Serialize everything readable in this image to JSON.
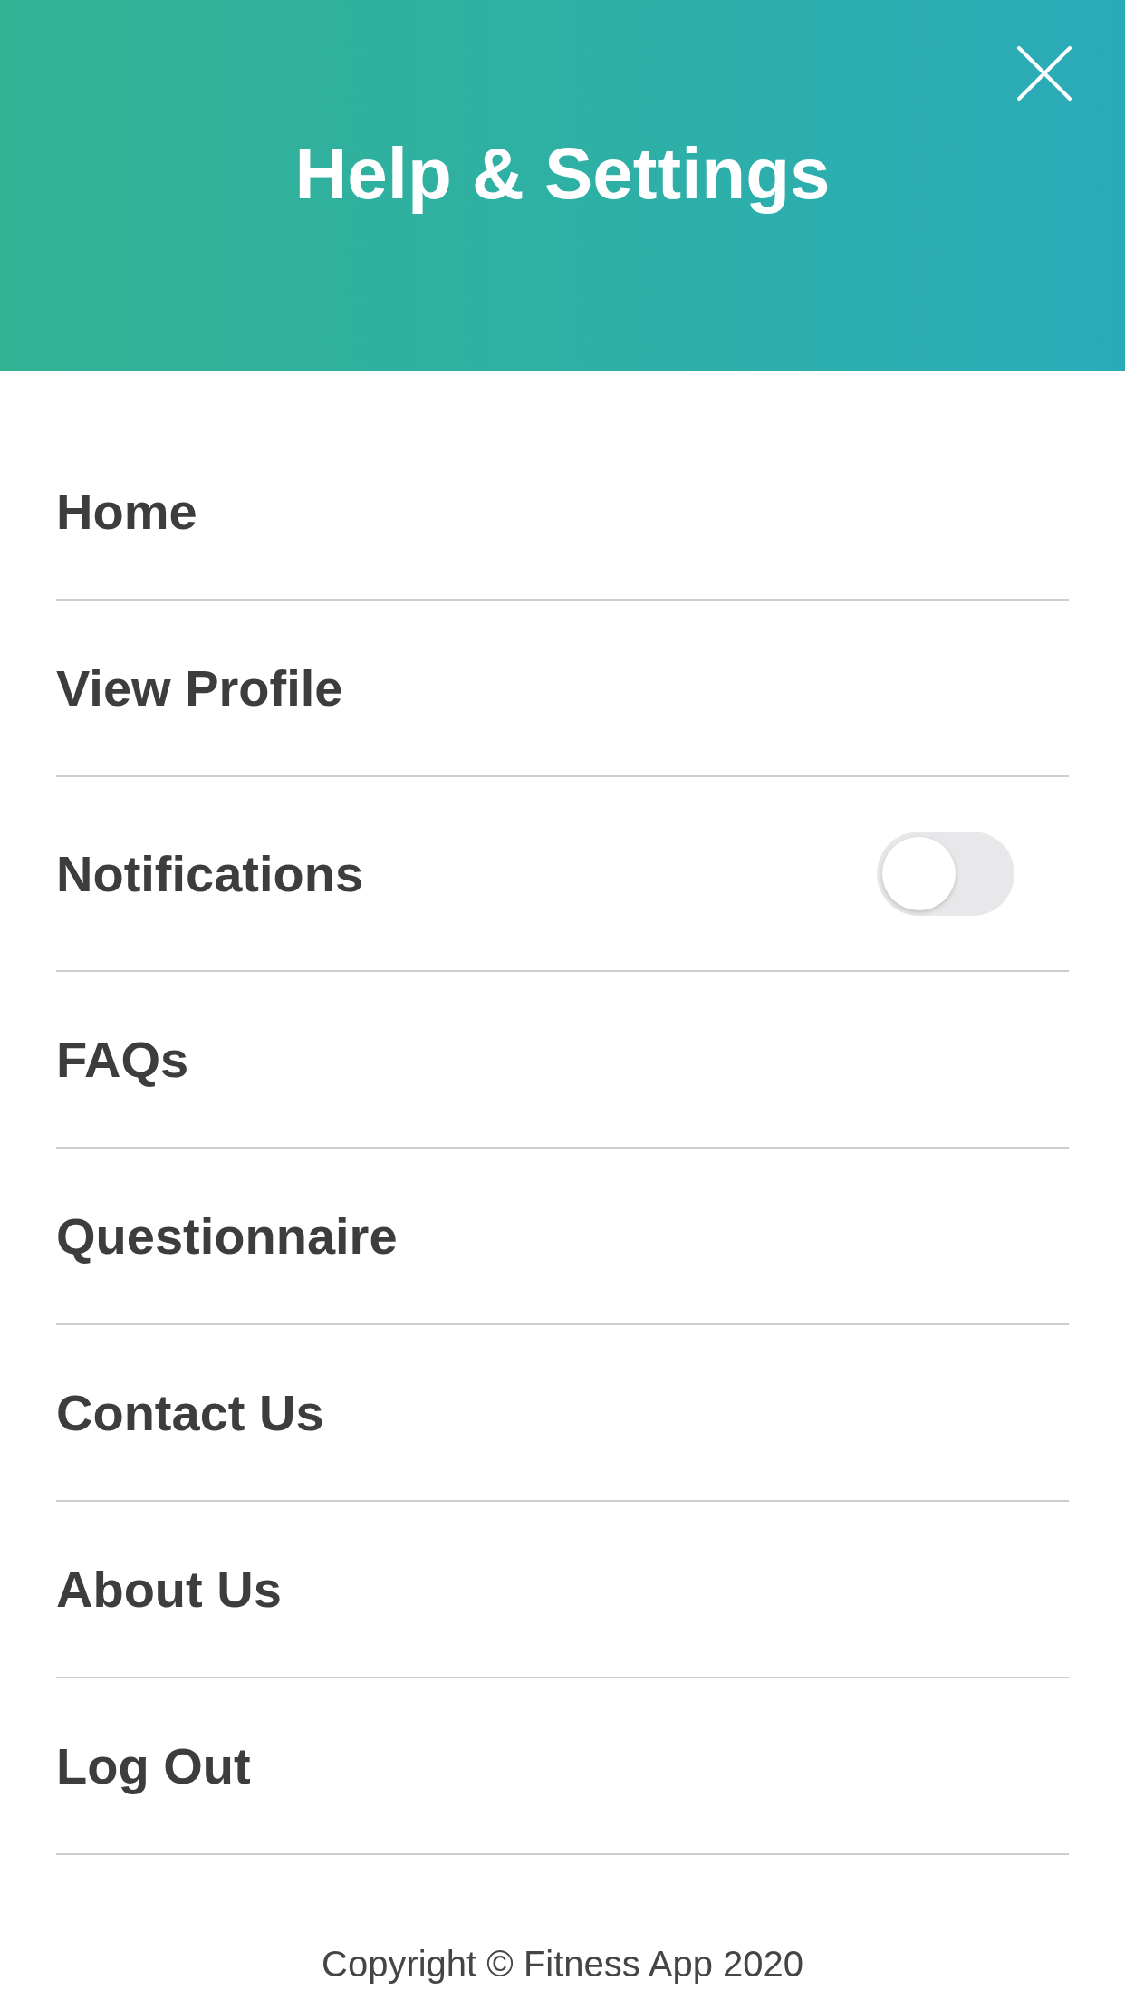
{
  "header": {
    "title": "Help & Settings"
  },
  "menu": [
    {
      "label": "Home",
      "kind": "link"
    },
    {
      "label": "View Profile",
      "kind": "link"
    },
    {
      "label": "Notifications",
      "kind": "toggle",
      "on": false
    },
    {
      "label": "FAQs",
      "kind": "link"
    },
    {
      "label": "Questionnaire",
      "kind": "link"
    },
    {
      "label": "Contact Us",
      "kind": "link"
    },
    {
      "label": "About Us",
      "kind": "link"
    },
    {
      "label": "Log Out",
      "kind": "link"
    }
  ],
  "footer": {
    "copyright": "Copyright © Fitness App 2020"
  }
}
